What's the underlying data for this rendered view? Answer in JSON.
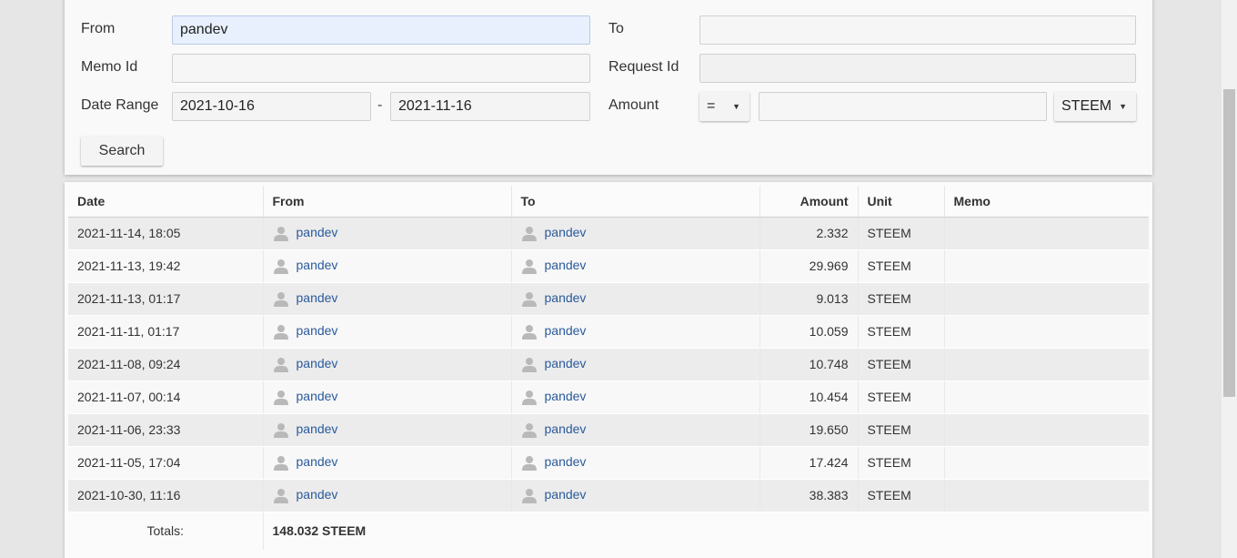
{
  "form": {
    "from_label": "From",
    "from_value": "pandev",
    "to_label": "To",
    "to_value": "",
    "memo_label": "Memo Id",
    "memo_value": "",
    "request_label": "Request Id",
    "request_value": "",
    "date_label": "Date Range",
    "date_from": "2021-10-16",
    "date_sep": "-",
    "date_to": "2021-11-16",
    "amount_label": "Amount",
    "amount_op": "=",
    "amount_value": "",
    "amount_unit": "STEEM",
    "search_button": "Search"
  },
  "table": {
    "headers": [
      "Date",
      "From",
      "To",
      "Amount",
      "Unit",
      "Memo"
    ],
    "rows": [
      {
        "date": "2021-11-14, 18:05",
        "from": "pandev",
        "to": "pandev",
        "amount": "2.332",
        "unit": "STEEM",
        "memo": ""
      },
      {
        "date": "2021-11-13, 19:42",
        "from": "pandev",
        "to": "pandev",
        "amount": "29.969",
        "unit": "STEEM",
        "memo": ""
      },
      {
        "date": "2021-11-13, 01:17",
        "from": "pandev",
        "to": "pandev",
        "amount": "9.013",
        "unit": "STEEM",
        "memo": ""
      },
      {
        "date": "2021-11-11, 01:17",
        "from": "pandev",
        "to": "pandev",
        "amount": "10.059",
        "unit": "STEEM",
        "memo": ""
      },
      {
        "date": "2021-11-08, 09:24",
        "from": "pandev",
        "to": "pandev",
        "amount": "10.748",
        "unit": "STEEM",
        "memo": ""
      },
      {
        "date": "2021-11-07, 00:14",
        "from": "pandev",
        "to": "pandev",
        "amount": "10.454",
        "unit": "STEEM",
        "memo": ""
      },
      {
        "date": "2021-11-06, 23:33",
        "from": "pandev",
        "to": "pandev",
        "amount": "19.650",
        "unit": "STEEM",
        "memo": ""
      },
      {
        "date": "2021-11-05, 17:04",
        "from": "pandev",
        "to": "pandev",
        "amount": "17.424",
        "unit": "STEEM",
        "memo": ""
      },
      {
        "date": "2021-10-30, 11:16",
        "from": "pandev",
        "to": "pandev",
        "amount": "38.383",
        "unit": "STEEM",
        "memo": ""
      }
    ],
    "totals_label": "Totals:",
    "totals_value": "148.032 STEEM"
  },
  "icons": {
    "user": "user-icon",
    "caret": "caret-down-icon"
  },
  "colors": {
    "link": "#2a5a9c",
    "active_input": "#e8f0fe"
  }
}
